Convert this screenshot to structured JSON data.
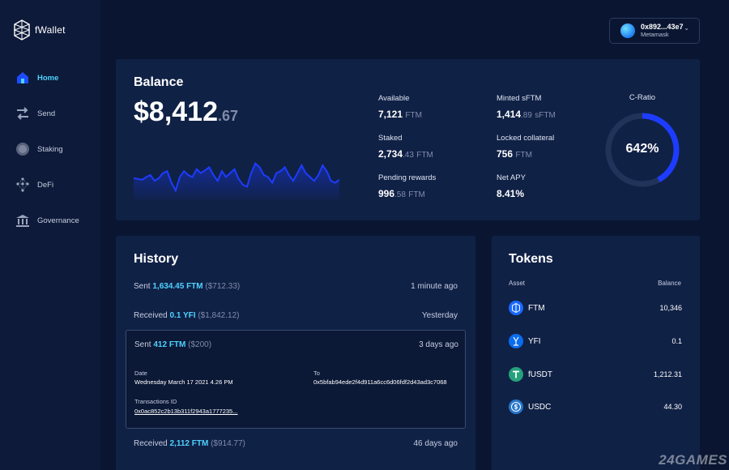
{
  "app": {
    "name": "fWallet"
  },
  "sidebar": {
    "items": [
      {
        "label": "Home",
        "icon": "home-icon",
        "active": true
      },
      {
        "label": "Send",
        "icon": "send-arrows-icon",
        "active": false
      },
      {
        "label": "Staking",
        "icon": "staking-coin-icon",
        "active": false
      },
      {
        "label": "DeFi",
        "icon": "defi-network-icon",
        "active": false
      },
      {
        "label": "Governance",
        "icon": "governance-building-icon",
        "active": false
      }
    ]
  },
  "wallet": {
    "address": "0x892...43e7",
    "provider": "Metamask",
    "chevron": "⌄"
  },
  "balance": {
    "title": "Balance",
    "amount_main": "$8,412",
    "amount_decimal": ".67",
    "sparkline": [
      0.42,
      0.4,
      0.38,
      0.45,
      0.5,
      0.35,
      0.42,
      0.55,
      0.6,
      0.3,
      0.1,
      0.45,
      0.6,
      0.5,
      0.45,
      0.65,
      0.55,
      0.62,
      0.7,
      0.5,
      0.35,
      0.6,
      0.45,
      0.55,
      0.65,
      0.4,
      0.25,
      0.2,
      0.55,
      0.8,
      0.7,
      0.5,
      0.45,
      0.3,
      0.55,
      0.6,
      0.7,
      0.5,
      0.35,
      0.55,
      0.75,
      0.55,
      0.45,
      0.35,
      0.5,
      0.75,
      0.6,
      0.35,
      0.3,
      0.38
    ]
  },
  "stats": {
    "available": {
      "label": "Available",
      "value": "7,121",
      "suffix": "FTM"
    },
    "staked": {
      "label": "Staked",
      "value": "2,734",
      "decimal": ".43",
      "suffix": "FTM"
    },
    "pending": {
      "label": "Pending rewards",
      "value": "996",
      "decimal": ".58",
      "suffix": "FTM"
    },
    "minted": {
      "label": "Minted sFTM",
      "value": "1,414",
      "decimal": ".89",
      "suffix": "sFTM"
    },
    "locked": {
      "label": "Locked collateral",
      "value": "756",
      "suffix": "FTM"
    },
    "apy": {
      "label": "Net APY",
      "value": "8.41%"
    }
  },
  "cratio": {
    "label": "C-Ratio",
    "value": "642%",
    "fill_fraction": 0.42,
    "accent": "#1d3cff"
  },
  "history": {
    "title": "History",
    "rows": [
      {
        "action": "Sent",
        "amount": "1,634.45 FTM",
        "usd": "($712.33)",
        "when": "1 minute ago"
      },
      {
        "action": "Received",
        "amount": "0.1 YFI",
        "usd": "($1,842.12)",
        "when": "Yesterday"
      },
      {
        "action": "Sent",
        "amount": "412 FTM",
        "usd": "($200)",
        "when": "3 days ago"
      },
      {
        "action": "Received",
        "amount": "2,112 FTM",
        "usd": "($914.77)",
        "when": "46 days ago"
      }
    ],
    "expanded": {
      "date_label": "Date",
      "date_value": "Wednesday March 17 2021 4.26 PM",
      "to_label": "To",
      "to_value": "0x5bfab94ede2f4d911a6cc6d06fdf2d43ad3c7068",
      "tx_label": "Transactions ID",
      "tx_value": "0x0ac852c2b13b311f2943a1777235..."
    }
  },
  "tokens": {
    "title": "Tokens",
    "col_asset": "Asset",
    "col_balance": "Balance",
    "rows": [
      {
        "name": "FTM",
        "balance": "10,346",
        "icon": "ftm-icon",
        "color": "#1969ff"
      },
      {
        "name": "YFI",
        "balance": "0.1",
        "icon": "yfi-icon",
        "color": "#0a6cf0"
      },
      {
        "name": "fUSDT",
        "balance": "1,212.31",
        "icon": "usdt-icon",
        "color": "#26a17b"
      },
      {
        "name": "USDC",
        "balance": "44.30",
        "icon": "usdc-icon",
        "color": "#2775ca"
      }
    ]
  },
  "watermark": "24GAMES"
}
